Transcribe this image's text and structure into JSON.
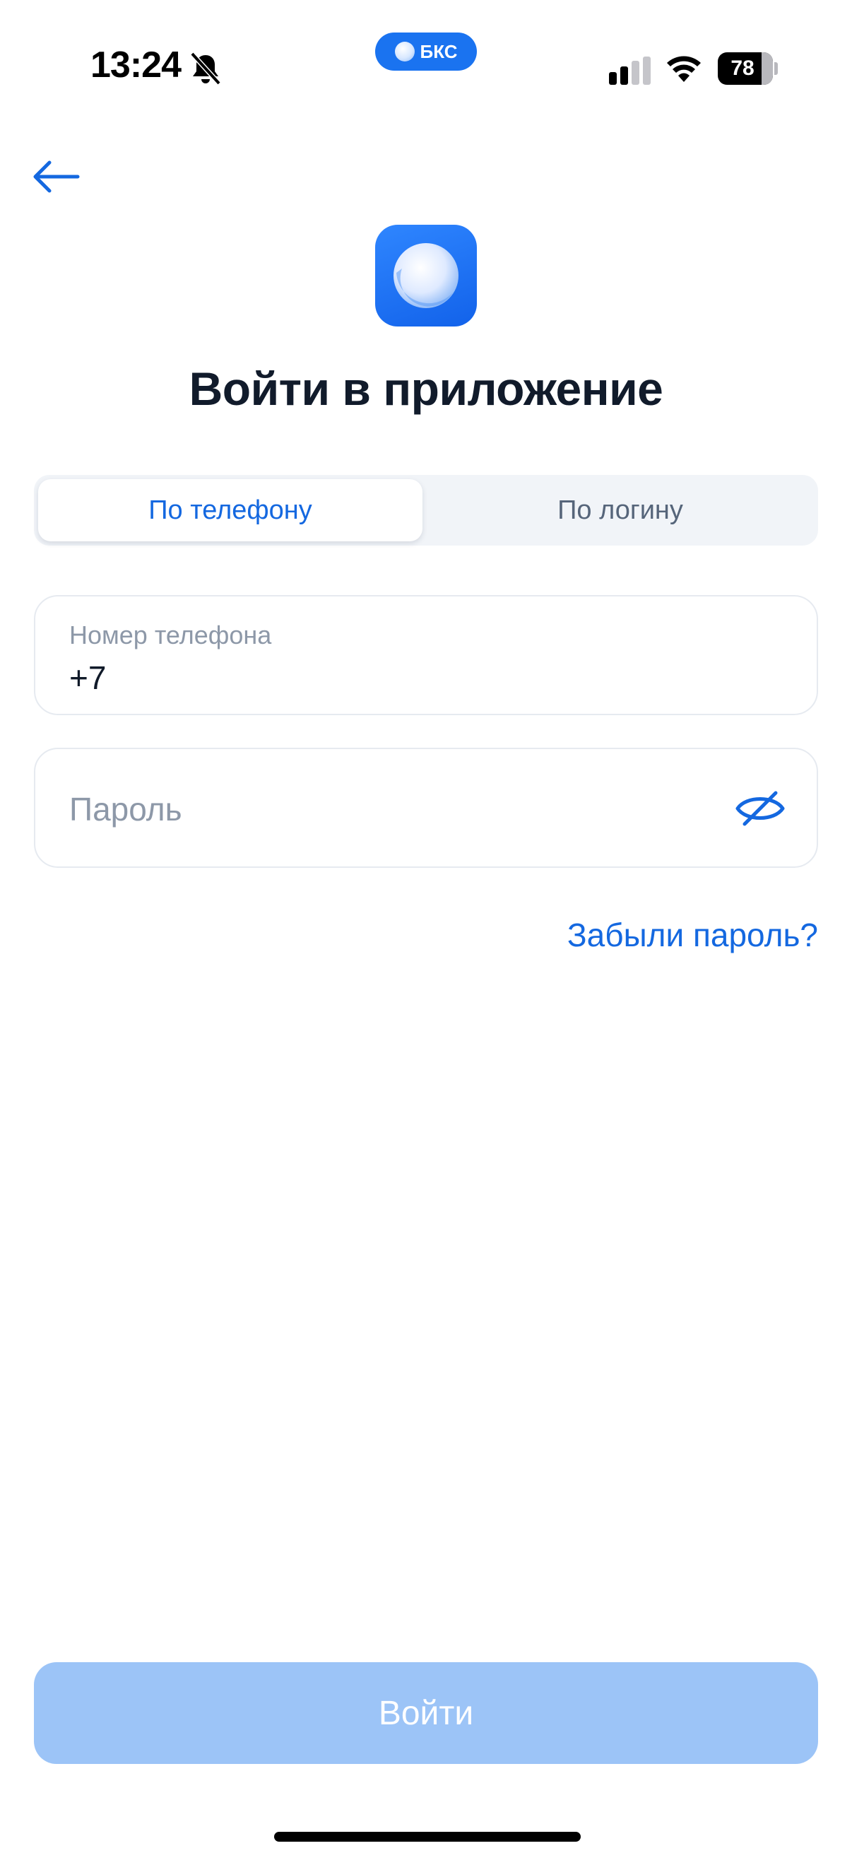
{
  "status_bar": {
    "time": "13:24",
    "island_label": "БКС",
    "battery_level": "78",
    "icons": [
      "bell-off-icon",
      "cellular-signal-icon",
      "wifi-icon",
      "battery-icon"
    ]
  },
  "nav": {
    "back_icon": "arrow-left-icon"
  },
  "header": {
    "title": "Войти в приложение"
  },
  "login_tabs": [
    {
      "label": "По телефону",
      "active": true
    },
    {
      "label": "По логину",
      "active": false
    }
  ],
  "phone_field": {
    "label": "Номер телефона",
    "value": "+7"
  },
  "password_field": {
    "placeholder": "Пароль",
    "icon": "eye-off-icon"
  },
  "forgot_link": "Забыли пароль?",
  "submit_label": "Войти",
  "colors": {
    "accent": "#1468e0",
    "button_disabled": "#9cc4f7",
    "segment_bg": "#f1f4f8",
    "logo_blue": "#1a73f0"
  }
}
